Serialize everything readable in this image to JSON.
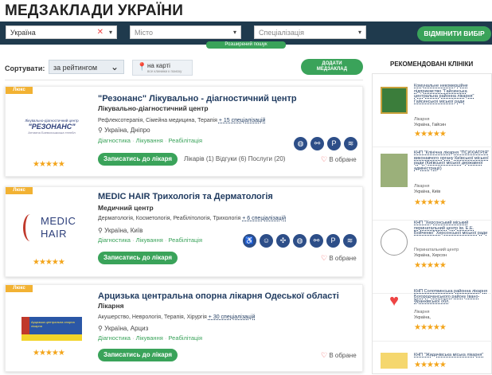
{
  "page": {
    "title": "МЕДЗАКЛАДИ УКРАЇНИ"
  },
  "filters": {
    "country": {
      "value": "Україна"
    },
    "city": {
      "placeholder": "Місто"
    },
    "specialization": {
      "placeholder": "Спеціалізація"
    },
    "reset_label": "ВІДМІНИТИ ВИБІР",
    "advanced_label": "Розширений пошук"
  },
  "toolbar": {
    "sort_label": "Сортувати:",
    "sort_value": "за рейтингом",
    "map_label": "на карті",
    "map_hint": "все клиники к поиску",
    "add_label_1": "ДОДАТИ",
    "add_label_2": "МЕДЗАКЛАД"
  },
  "clinics": [
    {
      "badge": "Люкс",
      "logo_line1": "Лікувально-діагностичний центр",
      "logo_line2": "\"РЕЗОНАНС\"",
      "logo_line3": "Антиина Боевохошкська тееейл",
      "name": "\"Резонанс\" Лікувально - діагностичний центр",
      "type": "Лікувально-діагностичний центр",
      "specs": "Рефлексотерапія, Сімейна медицина, Терапія",
      "specs_more": "+ 15 спеціалізацій",
      "location": "Україна, Дніпро",
      "tags": [
        "Діагностика",
        "Лікування",
        "Реабілітація"
      ],
      "book_label": "Записатись до лікаря",
      "stats": "Лікарів (1)   Відгуки (6)   Послуги (20)",
      "fav_label": "В обране",
      "rating": 5
    },
    {
      "badge": "Люкс",
      "logo_line1": "MEDIC",
      "logo_line2": "HAIR",
      "name": "MEDIC HAIR Трихологія та Дерматологія",
      "type": "Медичний центр",
      "specs": "Дерматологія, Косметологія, Реабілітологія, Трихологія",
      "specs_more": "+ 6 спеціалізацій",
      "location": "Україна, Київ",
      "tags": [
        "Діагностика",
        "Лікування",
        "Реабілітація"
      ],
      "book_label": "Записатись до лікаря",
      "fav_label": "В обране",
      "rating": 5
    },
    {
      "badge": "Люкс",
      "logo_line1": "Арцизька центральна опорна лікарня",
      "name": "Арцизька центральна опорна лікарня Одеської області",
      "type": "Лікарня",
      "specs": "Акушерство, Неврологія, Терапія, Хірургія",
      "specs_more": "+ 30 спеціалізацій",
      "location": "Україна, Арциз",
      "tags": [
        "Діагностика",
        "Лікування",
        "Реабілітація"
      ],
      "book_label": "Записатись до лікаря",
      "fav_label": "В обране",
      "rating": 5
    }
  ],
  "recommended": {
    "title": "РЕКОМЕНДОВАНІ КЛІНІКИ",
    "items": [
      {
        "name": "Комунальне некомерційне підприємство \"Гайсинська центральна районна лікарня\" Гайсинської міської ради",
        "type": "Лікарня",
        "location": "Україна, Гайсин"
      },
      {
        "name": "КНП \"Клінічна лікарня \"ПСИХІАТРІЯ\" виконавчого органу Київської міської ради (Київської міської державної адміністрації)",
        "type": "Лікарня",
        "location": "Україна, Київ"
      },
      {
        "name": "КНП \"Херсонський міський перинатальний центр ім. Е.Е. Бойченко\" Херсонської міської ради",
        "type": "Перинатальний центр",
        "location": "Україна, Херсон"
      },
      {
        "name": "КНП Солотвинська районна лікарня Богородчанського району Івано-Франківської обл.",
        "type": "Лікарня",
        "location": "Україна,"
      },
      {
        "name": "КНП \"Жидачівська міська лікарня\"",
        "type": "",
        "location": ""
      }
    ]
  },
  "colors": {
    "accent": "#3aa35a",
    "navy": "#1f3a4d",
    "star": "#f3a51c",
    "badge": "#f2b233"
  }
}
